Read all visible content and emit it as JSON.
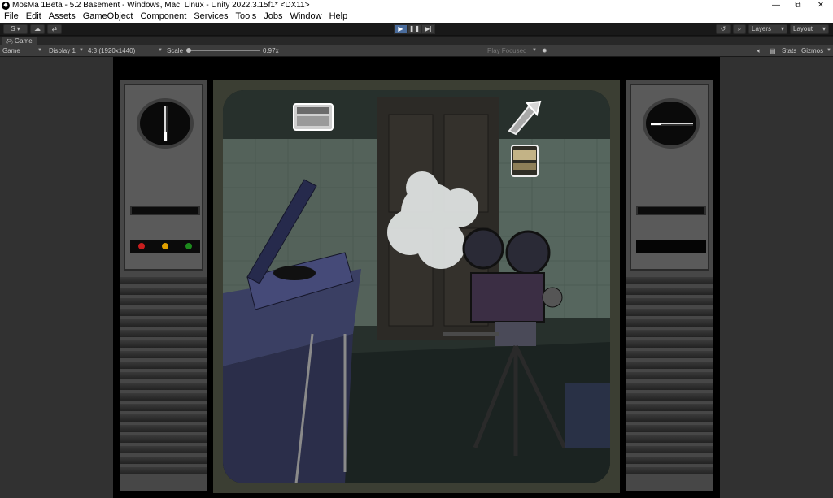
{
  "window": {
    "title": "MosMa 1Beta - 5.2 Basement - Windows, Mac, Linux - Unity 2022.3.15f1* <DX11>",
    "minimize": "—",
    "maximize": "⧉",
    "close": "✕"
  },
  "menu": [
    "File",
    "Edit",
    "Assets",
    "GameObject",
    "Component",
    "Services",
    "Tools",
    "Jobs",
    "Window",
    "Help"
  ],
  "toolbar": {
    "account_label": "S",
    "play_icon": "▶",
    "pause_icon": "❚❚",
    "step_icon": "▶|",
    "layers_label": "Layers",
    "layout_label": "Layout"
  },
  "game_tab": {
    "label": "Game"
  },
  "game_bar": {
    "mode": "Game",
    "display": "Display 1",
    "resolution": "4:3 (1920x1440)",
    "scale_label": "Scale",
    "scale_value": "0.97x",
    "play_focused": "Play Focused",
    "stats": "Stats",
    "gizmos": "Gizmos"
  },
  "scene": {
    "indicator_colors": [
      "#c81e1e",
      "#e0a000",
      "#1d8a1d"
    ],
    "inventory_icons": [
      "tape-recorder-icon",
      "flashlight-icon",
      "film-canister-icon"
    ]
  }
}
